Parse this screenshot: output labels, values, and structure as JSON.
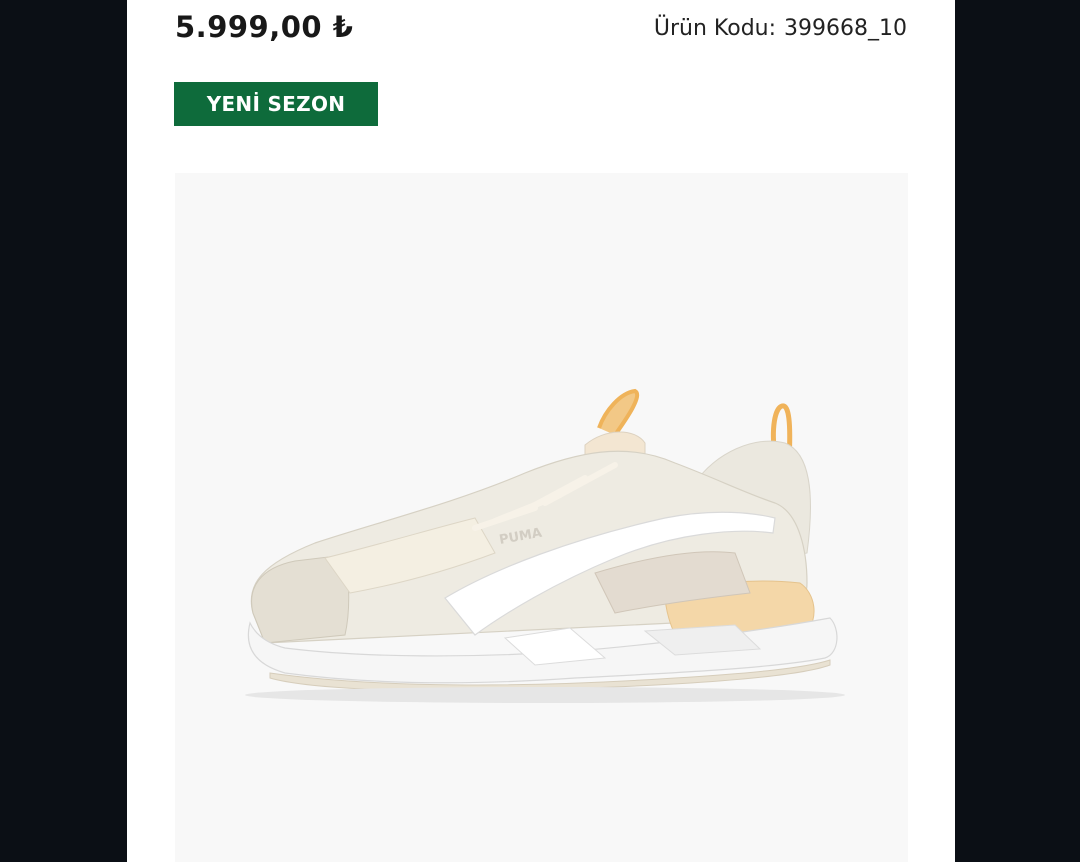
{
  "product": {
    "price": "5.999,00 ₺",
    "code_label": "Ürün Kodu:",
    "code_value": "399668_10",
    "badge": "YENİ SEZON",
    "image": {
      "brand_mark": "PUMA",
      "colors": {
        "background": "#f8f8f8",
        "upper": "#eeebe2",
        "sole": "#f6f6f6",
        "accent": "#f2d7a6",
        "loops": "#f0b35a",
        "stripe": "#ffffff"
      }
    }
  },
  "theme": {
    "badge_bg": "#0e6b3b",
    "page_bg": "#ffffff",
    "frame_bg": "#0b0f15",
    "text": "#181818"
  }
}
